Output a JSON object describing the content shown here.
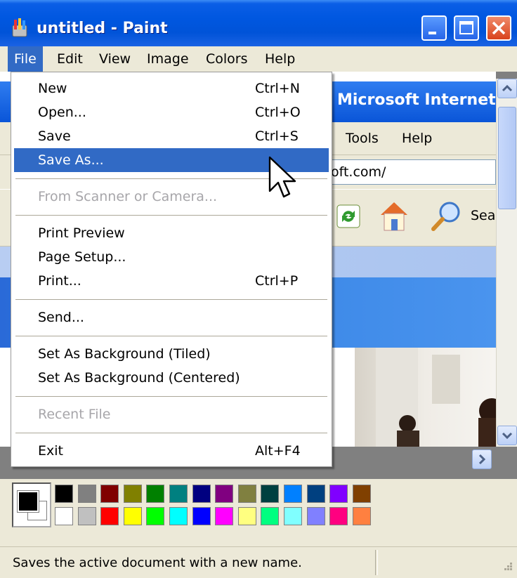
{
  "window": {
    "title": "untitled - Paint"
  },
  "menubar": {
    "items": [
      {
        "label": "File"
      },
      {
        "label": "Edit"
      },
      {
        "label": "View"
      },
      {
        "label": "Image"
      },
      {
        "label": "Colors"
      },
      {
        "label": "Help"
      }
    ]
  },
  "file_menu": {
    "new": {
      "label": "New",
      "shortcut": "Ctrl+N"
    },
    "open": {
      "label": "Open...",
      "shortcut": "Ctrl+O"
    },
    "save": {
      "label": "Save",
      "shortcut": "Ctrl+S"
    },
    "save_as": {
      "label": "Save As..."
    },
    "from_scanner": {
      "label": "From Scanner or Camera..."
    },
    "print_preview": {
      "label": "Print Preview"
    },
    "page_setup": {
      "label": "Page Setup..."
    },
    "print": {
      "label": "Print...",
      "shortcut": "Ctrl+P"
    },
    "send": {
      "label": "Send..."
    },
    "bg_tiled": {
      "label": "Set As Background (Tiled)"
    },
    "bg_centered": {
      "label": "Set As Background (Centered)"
    },
    "recent_file": {
      "label": "Recent File"
    },
    "exit": {
      "label": "Exit",
      "shortcut": "Alt+F4"
    }
  },
  "canvas_image": {
    "ie_title": "Microsoft Internet",
    "ie_menu_tools": "Tools",
    "ie_menu_help": "Help",
    "ie_address": "oft.com/",
    "ie_search": "Sea"
  },
  "palette": {
    "foreground": "#000000",
    "background": "#ffffff",
    "row1": [
      "#000000",
      "#808080",
      "#800000",
      "#808000",
      "#008000",
      "#008080",
      "#000080",
      "#800080",
      "#808040",
      "#004040",
      "#0080ff",
      "#004080",
      "#8000ff",
      "#804000"
    ],
    "row2": [
      "#ffffff",
      "#c0c0c0",
      "#ff0000",
      "#ffff00",
      "#00ff00",
      "#00ffff",
      "#0000ff",
      "#ff00ff",
      "#ffff80",
      "#00ff80",
      "#80ffff",
      "#8080ff",
      "#ff0080",
      "#ff8040"
    ]
  },
  "statusbar": {
    "text": "Saves the active document with a new name."
  }
}
